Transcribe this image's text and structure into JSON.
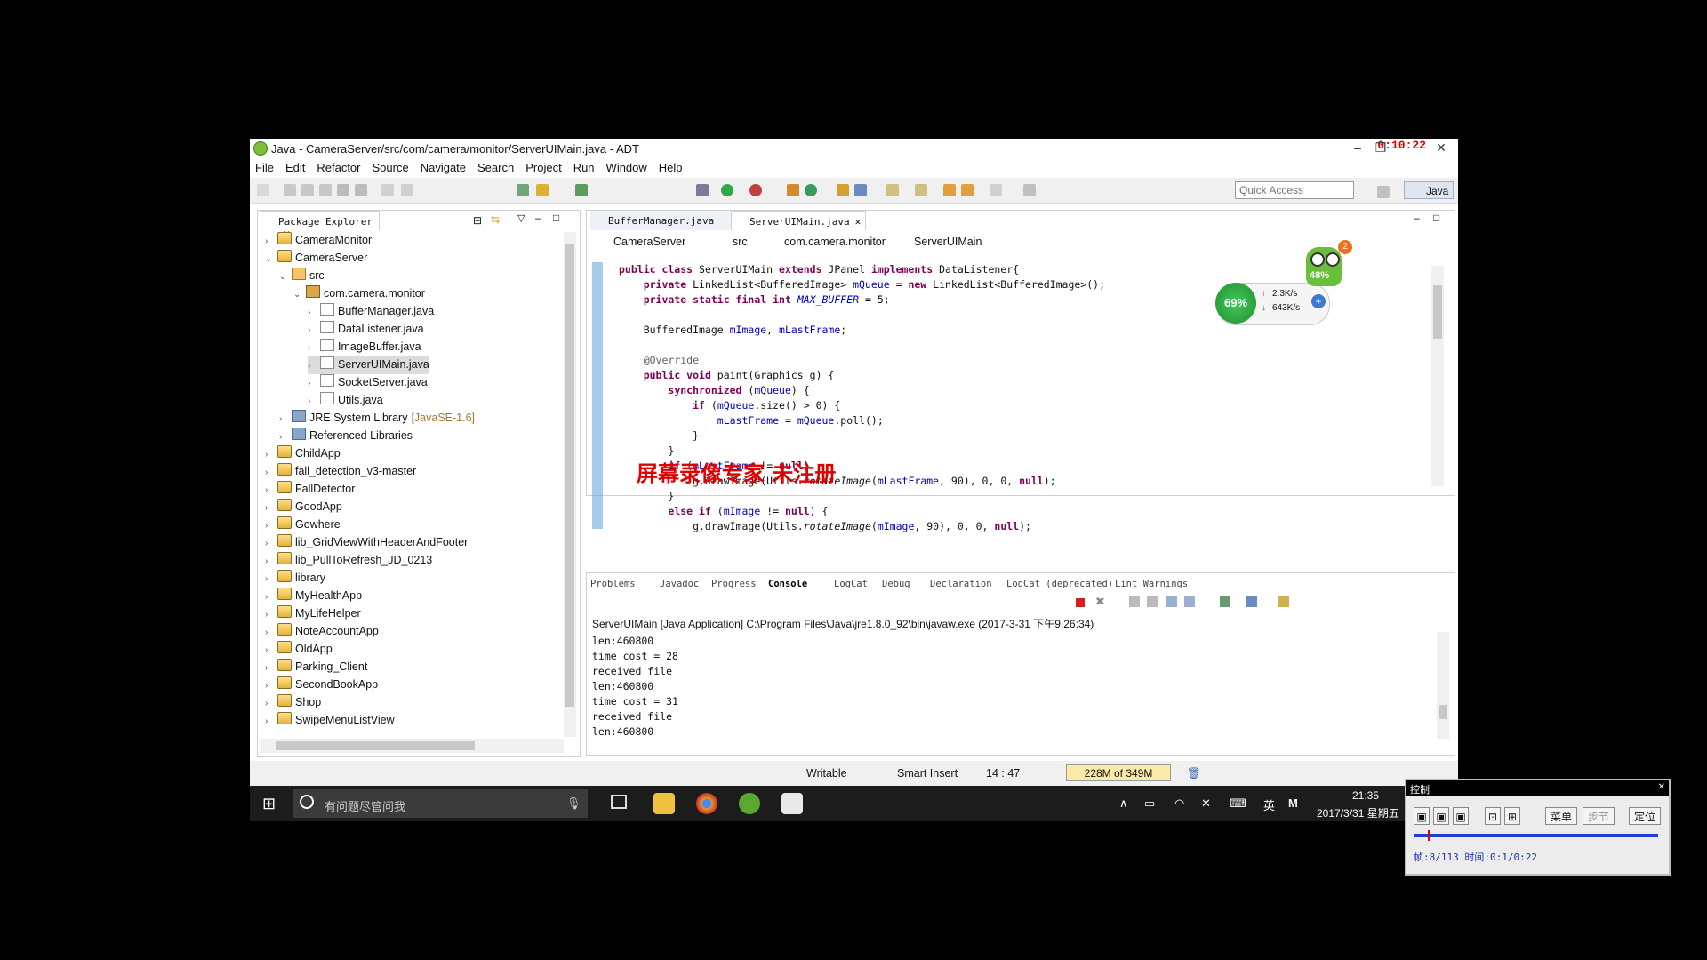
{
  "window": {
    "title": "Java - CameraServer/src/com/camera/monitor/ServerUIMain.java - ADT",
    "recording_clock": "0:10:22"
  },
  "menu": [
    "File",
    "Edit",
    "Refactor",
    "Source",
    "Navigate",
    "Search",
    "Project",
    "Run",
    "Window",
    "Help"
  ],
  "toolbar": {
    "quick_access_placeholder": "Quick Access",
    "perspective": "Java"
  },
  "package_explorer": {
    "tab": "Package Explorer",
    "items": [
      {
        "label": "CameraMonitor",
        "indent": 0,
        "arrow": "›",
        "icon": "proj"
      },
      {
        "label": "CameraServer",
        "indent": 0,
        "arrow": "⌄",
        "icon": "proj"
      },
      {
        "label": "src",
        "indent": 1,
        "arrow": "⌄",
        "icon": "src"
      },
      {
        "label": "com.camera.monitor",
        "indent": 2,
        "arrow": "⌄",
        "icon": "pkgi"
      },
      {
        "label": "BufferManager.java",
        "indent": 3,
        "arrow": "›",
        "icon": "jfile"
      },
      {
        "label": "DataListener.java",
        "indent": 3,
        "arrow": "›",
        "icon": "jfile"
      },
      {
        "label": "ImageBuffer.java",
        "indent": 3,
        "arrow": "›",
        "icon": "jfile"
      },
      {
        "label": "ServerUIMain.java",
        "indent": 3,
        "arrow": "›",
        "icon": "jfile",
        "selected": true
      },
      {
        "label": "SocketServer.java",
        "indent": 3,
        "arrow": "›",
        "icon": "jfile"
      },
      {
        "label": "Utils.java",
        "indent": 3,
        "arrow": "›",
        "icon": "jfile"
      },
      {
        "label": "JRE System Library",
        "suffix": "[JavaSE-1.6]",
        "indent": 1,
        "arrow": "›",
        "icon": "lib"
      },
      {
        "label": "Referenced Libraries",
        "indent": 1,
        "arrow": "›",
        "icon": "lib"
      },
      {
        "label": "ChildApp",
        "indent": 0,
        "arrow": "›",
        "icon": "proj"
      },
      {
        "label": "fall_detection_v3-master",
        "indent": 0,
        "arrow": "›",
        "icon": "proj"
      },
      {
        "label": "FallDetector",
        "indent": 0,
        "arrow": "›",
        "icon": "proj"
      },
      {
        "label": "GoodApp",
        "indent": 0,
        "arrow": "›",
        "icon": "proj"
      },
      {
        "label": "Gowhere",
        "indent": 0,
        "arrow": "›",
        "icon": "proj"
      },
      {
        "label": "lib_GridViewWithHeaderAndFooter",
        "indent": 0,
        "arrow": "›",
        "icon": "proj"
      },
      {
        "label": "lib_PullToRefresh_JD_0213",
        "indent": 0,
        "arrow": "›",
        "icon": "proj"
      },
      {
        "label": "library",
        "indent": 0,
        "arrow": "›",
        "icon": "proj"
      },
      {
        "label": "MyHealthApp",
        "indent": 0,
        "arrow": "›",
        "icon": "proj"
      },
      {
        "label": "MyLifeHelper",
        "indent": 0,
        "arrow": "›",
        "icon": "proj"
      },
      {
        "label": "NoteAccountApp",
        "indent": 0,
        "arrow": "›",
        "icon": "proj"
      },
      {
        "label": "OldApp",
        "indent": 0,
        "arrow": "›",
        "icon": "proj"
      },
      {
        "label": "Parking_Client",
        "indent": 0,
        "arrow": "›",
        "icon": "proj"
      },
      {
        "label": "SecondBookApp",
        "indent": 0,
        "arrow": "›",
        "icon": "proj"
      },
      {
        "label": "Shop",
        "indent": 0,
        "arrow": "›",
        "icon": "proj"
      },
      {
        "label": "SwipeMenuListView",
        "indent": 0,
        "arrow": "›",
        "icon": "proj"
      }
    ]
  },
  "editor": {
    "tabs": [
      "BufferManager.java",
      "ServerUIMain.java"
    ],
    "breadcrumb": [
      "CameraServer",
      "src",
      "com.camera.monitor",
      "ServerUIMain"
    ],
    "watermark": "屏幕录像专家  未注册"
  },
  "widget": {
    "percent": "69%",
    "up": "2.3K/s",
    "down": "643K/s",
    "owl_percent": "48%",
    "owl_badge": "2"
  },
  "console": {
    "tabs": [
      "Problems",
      "Javadoc",
      "Progress",
      "Console",
      "LogCat",
      "Debug",
      "Declaration",
      "LogCat (deprecated)",
      "Lint Warnings"
    ],
    "header": "ServerUIMain [Java Application] C:\\Program Files\\Java\\jre1.8.0_92\\bin\\javaw.exe (2017-3-31 下午9:26:34)",
    "lines": [
      "len:460800",
      "time cost = 28",
      "received file",
      "len:460800",
      "time cost = 31",
      "received file",
      "len:460800"
    ]
  },
  "status": {
    "writable": "Writable",
    "insert": "Smart Insert",
    "position": "14 : 47",
    "heap": "228M of 349M"
  },
  "taskbar": {
    "search_placeholder": "有问题尽管问我",
    "time": "21:35",
    "date": "2017/3/31 星期五",
    "ime": "英"
  },
  "control_panel": {
    "title": "控制",
    "menu_label": "菜单",
    "step_label": "步节",
    "locate_label": "定位",
    "info": "帧:8/113 时间:0:1/0:22"
  }
}
